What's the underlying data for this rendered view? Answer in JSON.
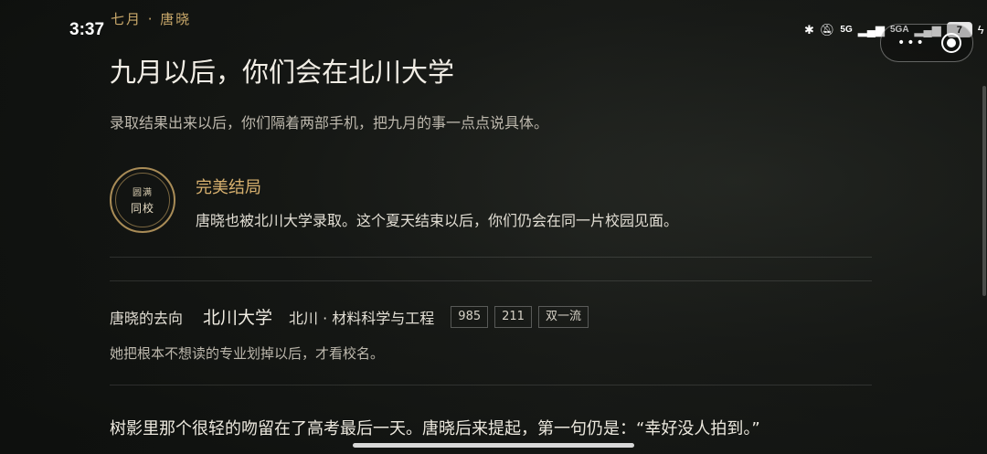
{
  "status_bar": {
    "time": "3:37",
    "network_1": "5G",
    "network_2": "5GA",
    "battery": "7",
    "icons": [
      "bluetooth-icon",
      "mute-icon",
      "signal-icon",
      "battery-icon",
      "charging-icon"
    ]
  },
  "breadcrumb": "七月 · 唐晓",
  "title": "九月以后，你们会在北川大学",
  "subtitle": "录取结果出来以后，你们隔着两部手机，把九月的事一点点说具体。",
  "ending": {
    "seal_line1": "圆满",
    "seal_line2": "同校",
    "title": "完美结局",
    "description": "唐晓也被北川大学录取。这个夏天结束以后，你们仍会在同一片校园见面。"
  },
  "destination": {
    "label": "唐晓的去向",
    "school": "北川大学",
    "major": "北川 · 材料科学与工程",
    "tags": [
      "985",
      "211",
      "双一流"
    ],
    "note": "她把根本不想读的专业划掉以后，才看校名。"
  },
  "story_line": "树影里那个很轻的吻留在了高考最后一天。唐晓后来提起，第一句仍是：“幸好没人拍到。”",
  "colors": {
    "accent_gold": "#c9a86a",
    "background": "#1b1d1a"
  }
}
